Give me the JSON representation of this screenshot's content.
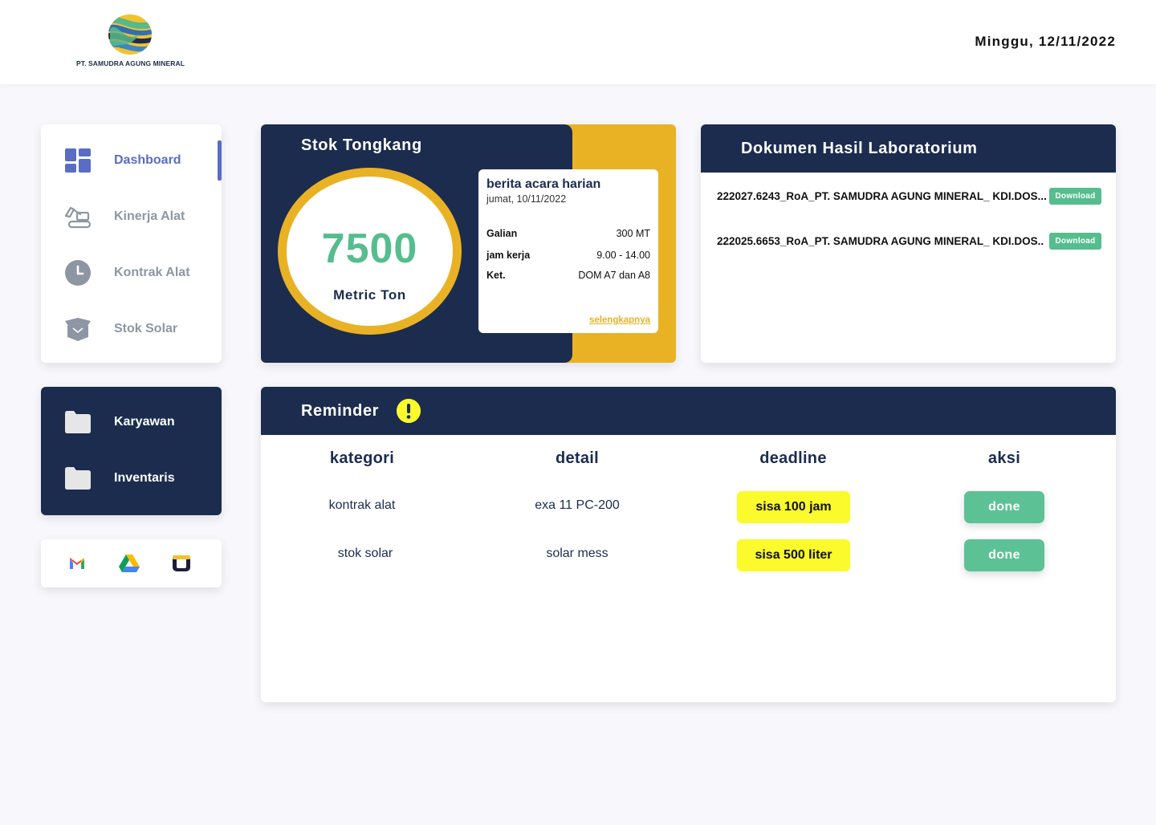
{
  "header": {
    "company_name": "PT. SAMUDRA AGUNG MINERAL",
    "date": "Minggu, 12/11/2022"
  },
  "sidebar": {
    "items": [
      {
        "label": "Dashboard",
        "icon": "dashboard-grid-icon",
        "active": true
      },
      {
        "label": "Kinerja Alat",
        "icon": "excavator-icon",
        "active": false
      },
      {
        "label": "Kontrak Alat",
        "icon": "clock-icon",
        "active": false
      },
      {
        "label": "Stok Solar",
        "icon": "box-icon",
        "active": false
      }
    ],
    "folders": [
      {
        "label": "Karyawan",
        "icon": "folder-icon"
      },
      {
        "label": "Inventaris",
        "icon": "folder-icon"
      }
    ],
    "apps": [
      {
        "name": "gmail",
        "icon": "gmail-icon"
      },
      {
        "name": "google drive",
        "icon": "google-drive-icon"
      },
      {
        "name": "app",
        "icon": "square-app-icon"
      }
    ]
  },
  "stok": {
    "title": "Stok Tongkang",
    "value": "7500",
    "unit": "Metric Ton",
    "berita": {
      "title": "berita acara harian",
      "date": "jumat, 10/11/2022",
      "rows": [
        {
          "key": "Galian",
          "value": "300 MT"
        },
        {
          "key": "jam kerja",
          "value": "9.00 - 14.00"
        },
        {
          "key": "Ket.",
          "value": "DOM A7 dan A8"
        }
      ],
      "more_link": "selengkapnya"
    }
  },
  "dokumen": {
    "title": "Dokumen Hasil Laboratorium",
    "files": [
      {
        "name": "222027.6243_RoA_PT. SAMUDRA AGUNG MINERAL_ KDI.DOS...",
        "action": "Download"
      },
      {
        "name": "222025.6653_RoA_PT. SAMUDRA AGUNG MINERAL_ KDI.DOS..",
        "action": "Download"
      }
    ]
  },
  "reminder": {
    "title": "Reminder",
    "columns": [
      "kategori",
      "detail",
      "deadline",
      "aksi"
    ],
    "rows": [
      {
        "kategori": "kontrak alat",
        "detail": "exa 11 PC-200",
        "deadline": "sisa 100 jam",
        "aksi": "done"
      },
      {
        "kategori": "stok solar",
        "detail": "solar mess",
        "deadline": "sisa 500 liter",
        "aksi": "done"
      }
    ]
  },
  "colors": {
    "navy": "#1b2c4f",
    "accent_gold": "#e9b224",
    "green": "#55bd8e",
    "highlight_yellow": "#fafa2c",
    "active_nav": "#5b6cc4"
  }
}
